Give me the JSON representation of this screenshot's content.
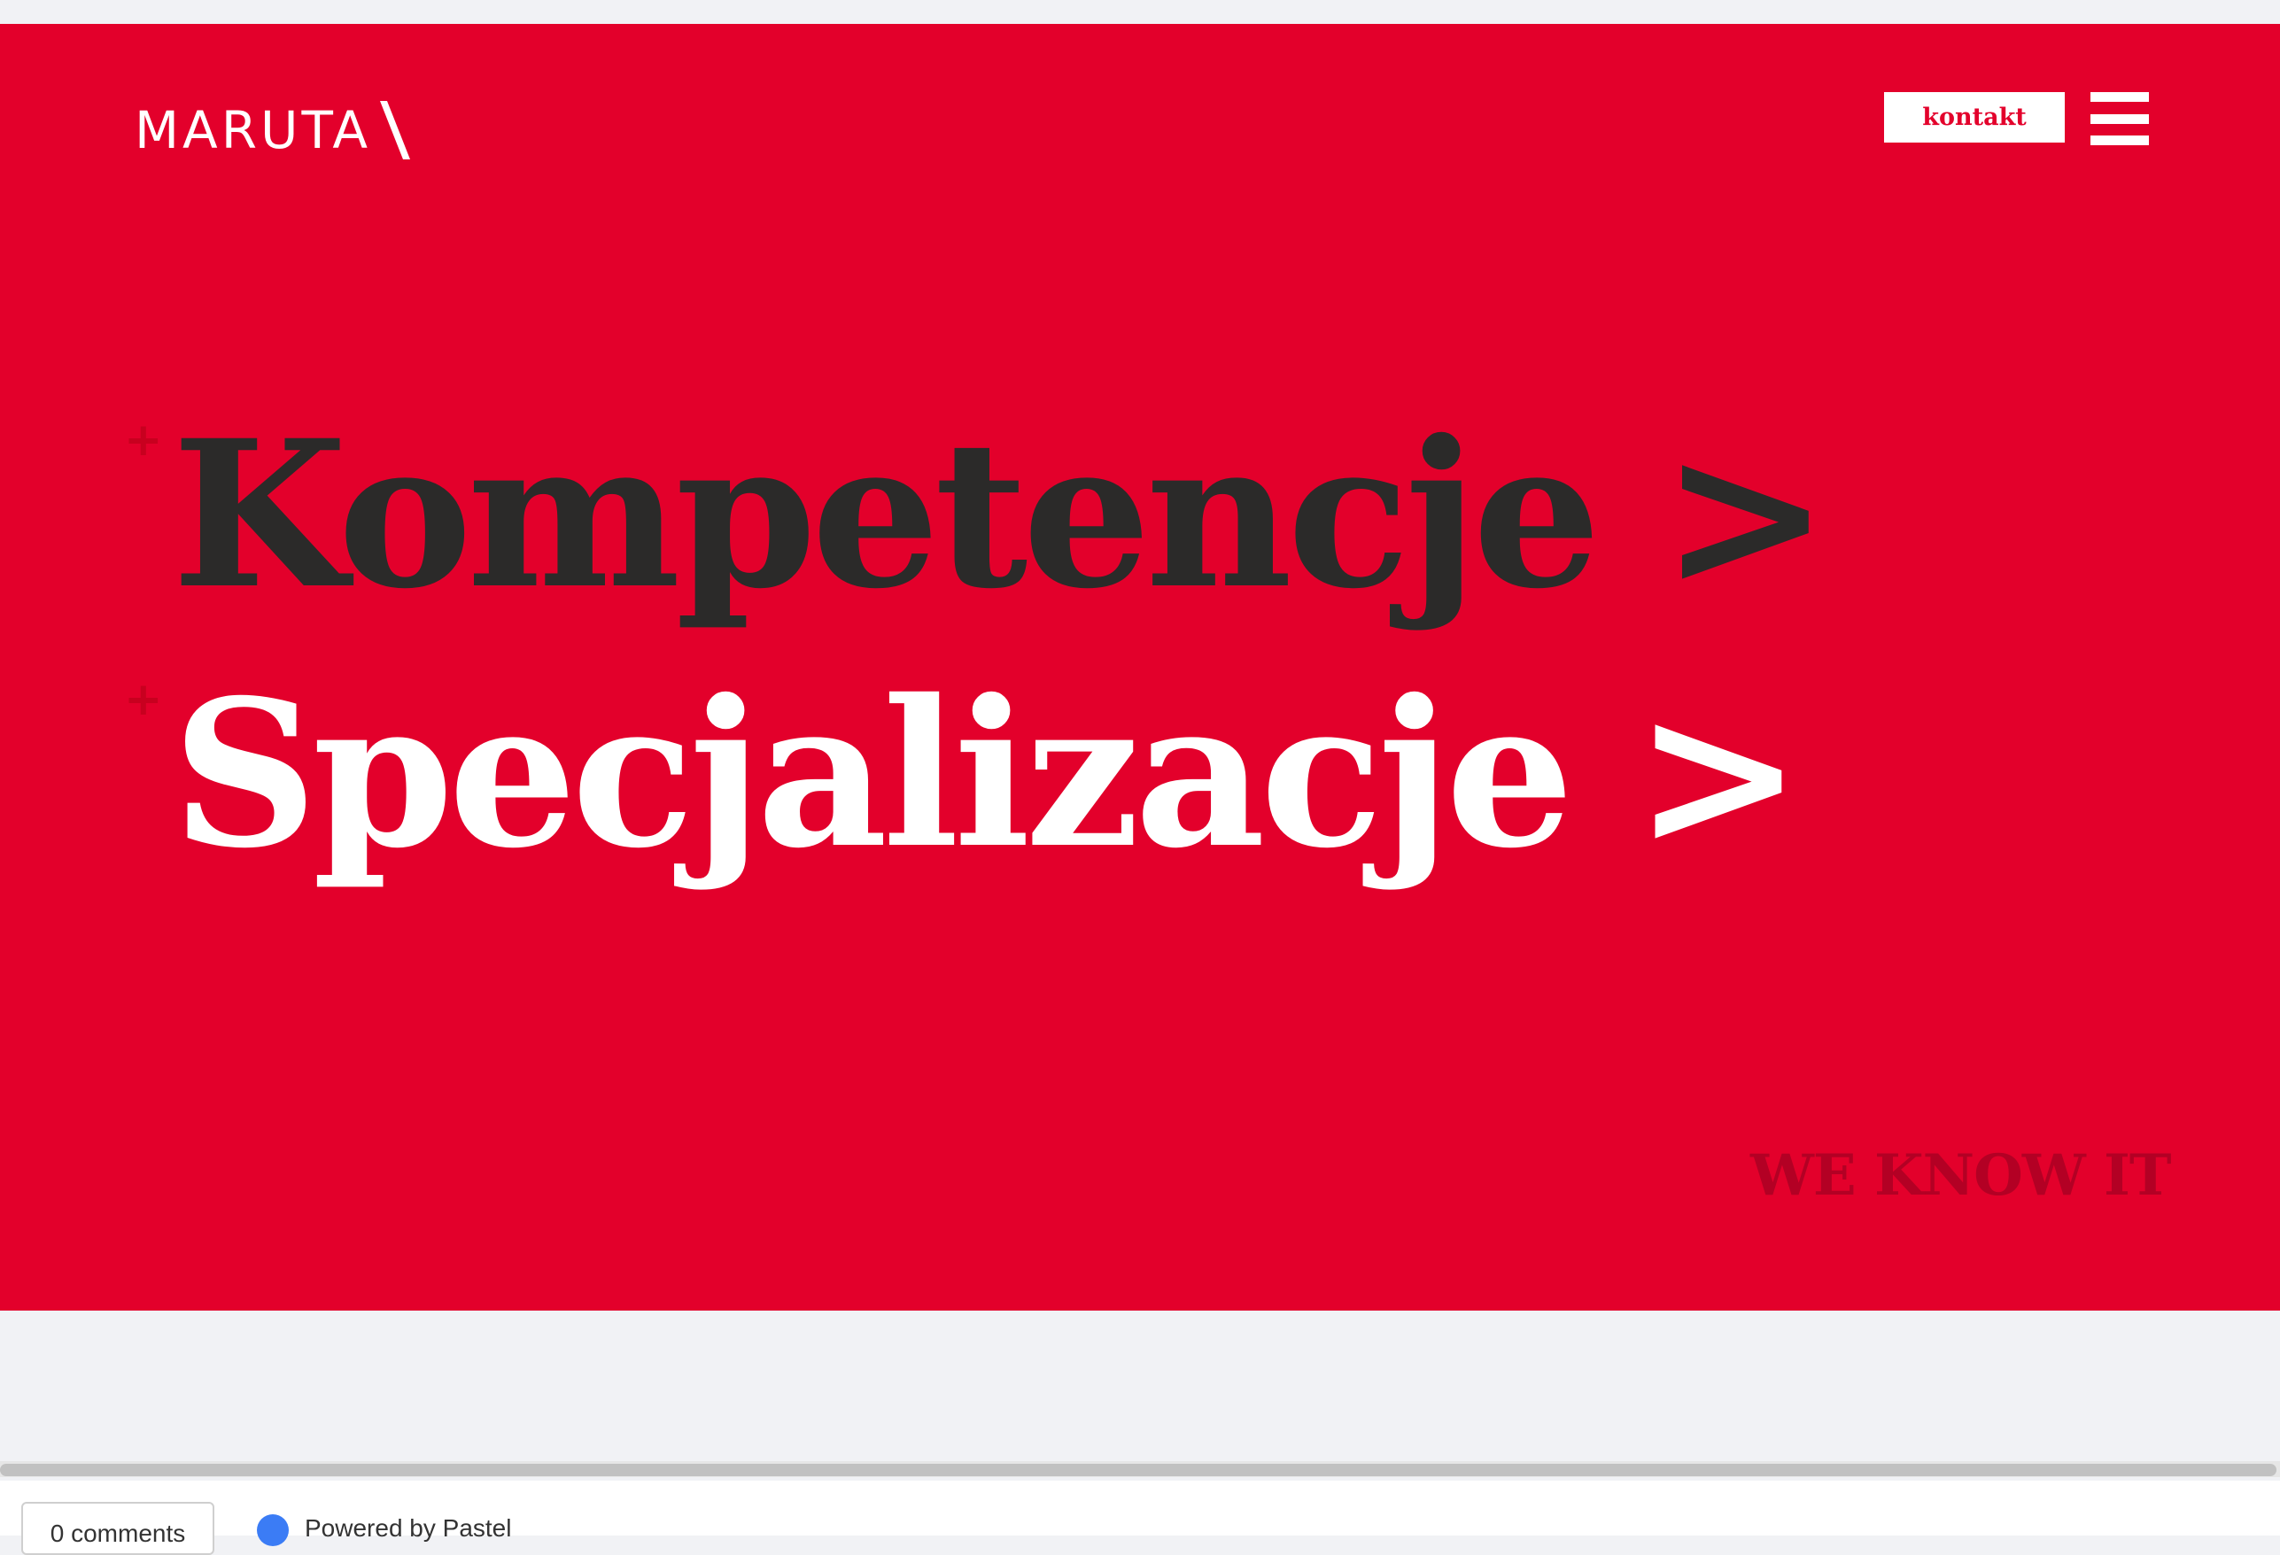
{
  "header": {
    "logo_text": "MARUTA",
    "contact_label": "kontakt"
  },
  "menu": {
    "items": [
      {
        "label": "Kompetencje >",
        "color": "#2b2a29"
      },
      {
        "label": "Specjalizacje >",
        "color": "#ffffff"
      }
    ],
    "plus_glyph": "+"
  },
  "tagline": "WE KNOW IT",
  "footer": {
    "comments_label": "0 comments",
    "powered_label": "Powered by Pastel"
  },
  "colors": {
    "brand_red": "#e3002b",
    "page_bg": "#f1f2f5"
  },
  "icons": {
    "menu": "hamburger-icon",
    "logo": "maruta-logo",
    "pastel": "pastel-icon"
  }
}
